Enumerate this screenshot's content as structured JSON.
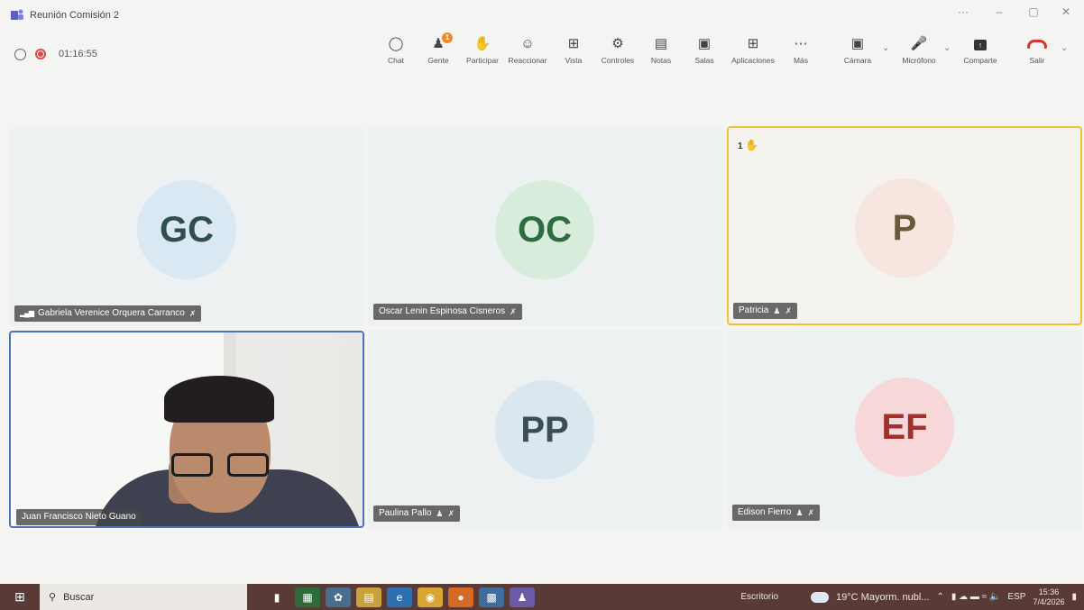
{
  "window": {
    "title": "Reunión Comisión 2",
    "controls": [
      "···",
      "–",
      "▢",
      "✕"
    ]
  },
  "status": {
    "timer": "01:16:55"
  },
  "toolbar": {
    "chat": "Chat",
    "people": "Gente",
    "people_badge": "1",
    "raise": "Participar",
    "react": "Reaccionar",
    "view": "Vista",
    "controls": "Controles",
    "notes": "Notas",
    "rooms": "Salas",
    "apps": "Aplicaciones",
    "more": "Más",
    "camera": "Cámara",
    "mic": "Micrófono",
    "share": "Comparte",
    "leave": "Salir"
  },
  "participants": [
    {
      "initials": "GC",
      "name": "Gabriela Verenice Orquera Carranco",
      "color": "#2f4f4f",
      "bg": "#d9e8f3"
    },
    {
      "initials": "OC",
      "name": "Oscar Lenin Espinosa Cisneros",
      "color": "#2e6b3e",
      "bg": "#d8ecdc"
    },
    {
      "initials": "P",
      "name": "Patricia",
      "color": "#6b5a3a",
      "bg": "#f7e6df",
      "hand_count": "1"
    },
    {
      "initials": "",
      "name": "Juan Francisco Nieto Guano"
    },
    {
      "initials": "PP",
      "name": "Paulina Pallo",
      "color": "#3c4d55",
      "bg": "#dbe7ee"
    },
    {
      "initials": "EF",
      "name": "Edison Fierro",
      "color": "#a0302b",
      "bg": "#f6d8d8"
    }
  ],
  "taskbar": {
    "search": "Buscar",
    "desktop": "Escritorio",
    "weather": "19°C  Mayorm. nubl...",
    "lang": "ESP",
    "time": "15:36",
    "date": "7/4/2026"
  },
  "colors": {
    "highlight_yellow": "#f1c232",
    "active_blue": "#4a72b8",
    "record_red": "#e0484d",
    "leave_red": "#d9342b",
    "taskbar": "#5a3a36"
  }
}
